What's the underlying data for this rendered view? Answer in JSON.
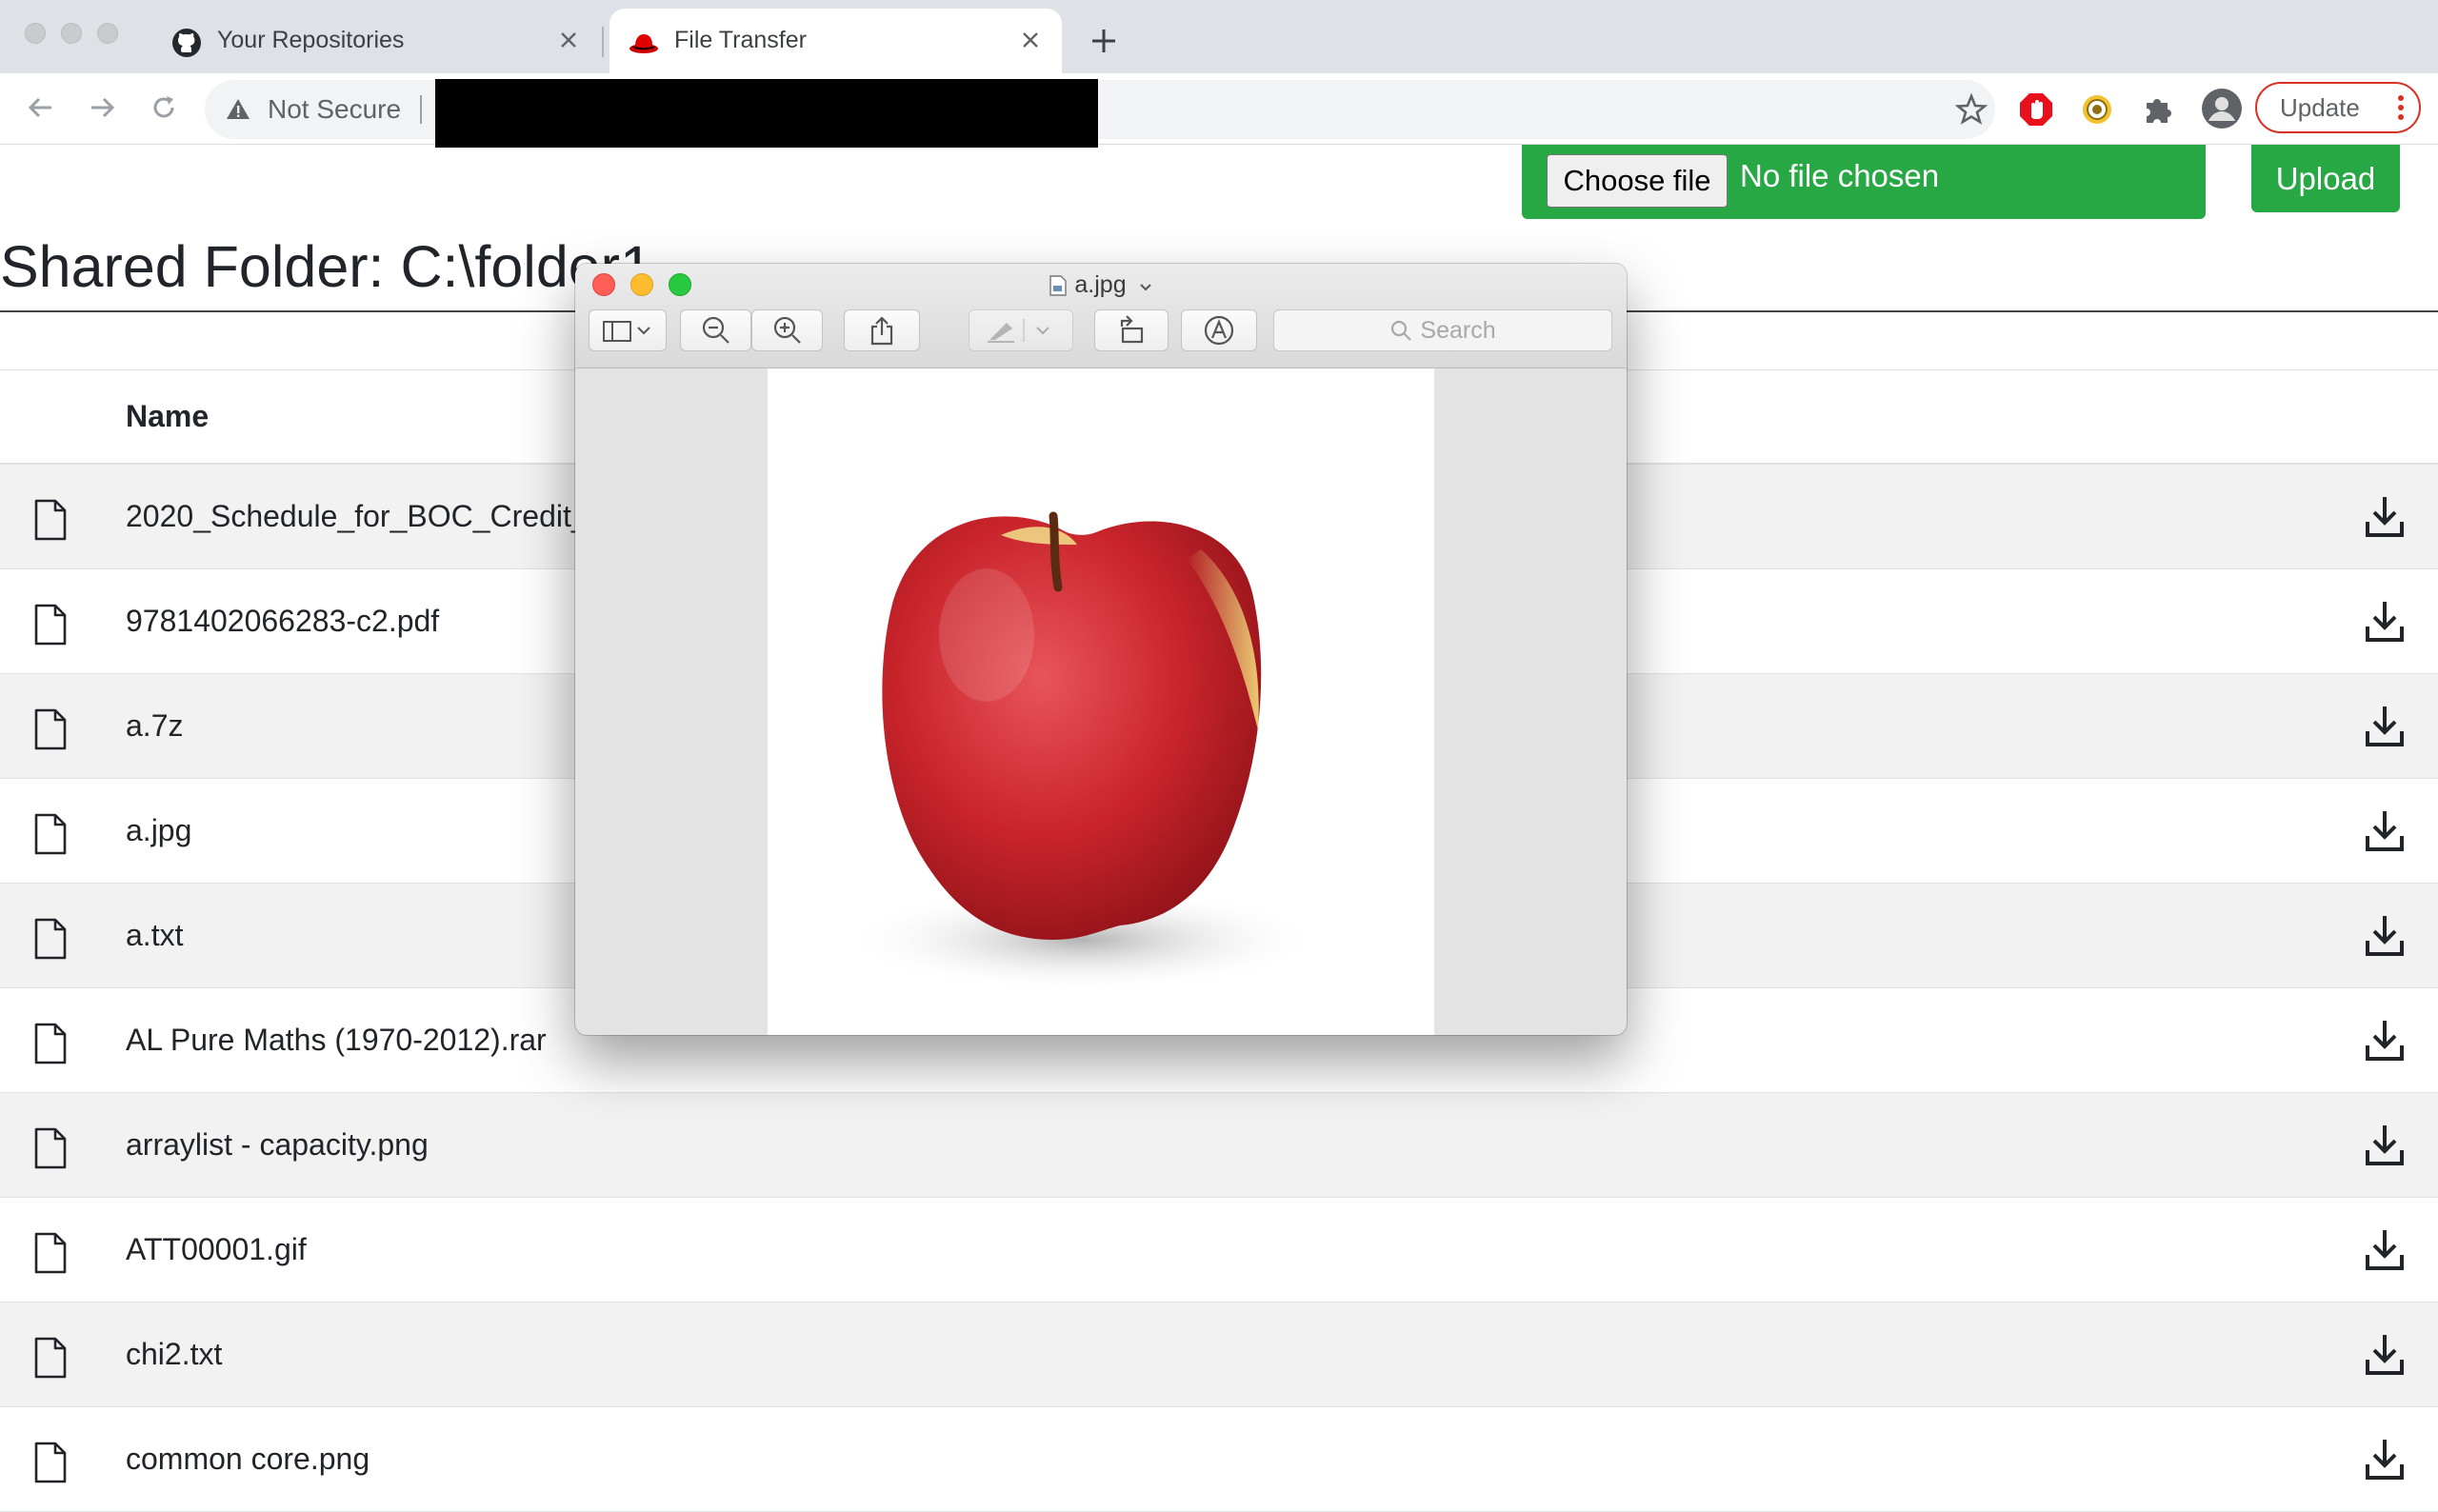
{
  "browser": {
    "tabs": [
      {
        "title": "Your Repositories",
        "icon": "github-icon"
      },
      {
        "title": "File Transfer",
        "icon": "redhat-icon"
      }
    ],
    "address_bar": {
      "security_label": "Not Secure"
    },
    "update_label": "Update"
  },
  "page": {
    "upload": {
      "choose_label": "Choose file",
      "no_file_text": "No file chosen",
      "upload_label": "Upload"
    },
    "title": "Shared Folder: C:\\folder1",
    "table": {
      "header_name": "Name",
      "rows": [
        "2020_Schedule_for_BOC_Credit_Card_Promotion.pdf",
        "9781402066283-c2.pdf",
        "a.7z",
        "a.jpg",
        "a.txt",
        "AL Pure Maths (1970-2012).rar",
        "arraylist - capacity.png",
        "ATT00001.gif",
        "chi2.txt",
        "common core.png"
      ]
    }
  },
  "preview_window": {
    "filename": "a.jpg",
    "search_placeholder": "Search",
    "image_subject": "red apple"
  },
  "colors": {
    "accent_green": "#28a745",
    "update_red": "#d93025"
  }
}
